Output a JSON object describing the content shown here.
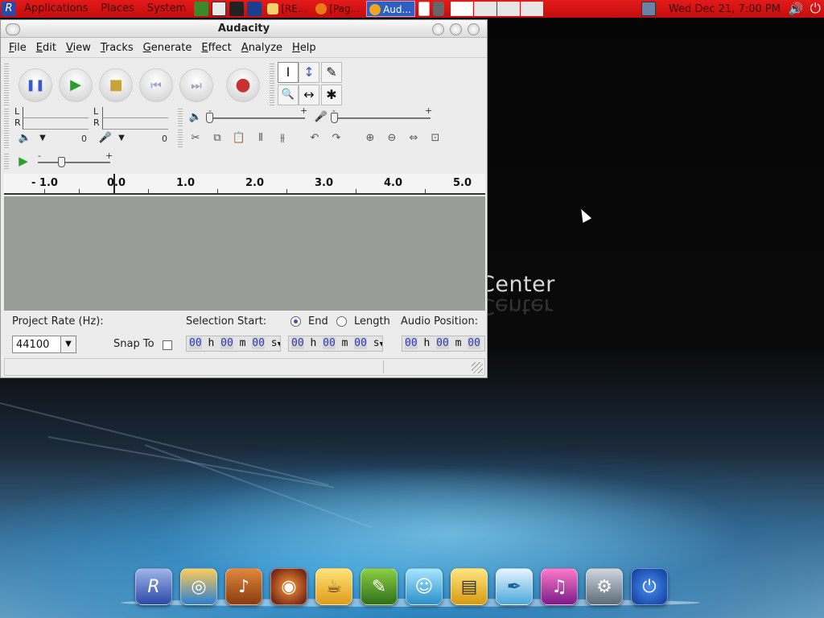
{
  "top_panel": {
    "menus": [
      "Applications",
      "Places",
      "System"
    ],
    "tasks": [
      {
        "label": "[RE...",
        "active": false
      },
      {
        "label": "[Pag...",
        "active": false
      },
      {
        "label": "Aud...",
        "active": true
      }
    ],
    "clock": "Wed Dec 21,  7:00 PM"
  },
  "window": {
    "title": "Audacity",
    "menus": [
      {
        "first": "F",
        "rest": "ile"
      },
      {
        "first": "E",
        "rest": "dit"
      },
      {
        "first": "V",
        "rest": "iew"
      },
      {
        "first": "T",
        "rest": "racks"
      },
      {
        "first": "G",
        "rest": "enerate"
      },
      {
        "first": "E",
        "rest": "ffect"
      },
      {
        "first": "A",
        "rest": "nalyze"
      },
      {
        "first": "H",
        "rest": "elp"
      }
    ],
    "transport": {
      "pause": "❚❚",
      "play": "▶",
      "stop": "■",
      "skip_start": "⏮",
      "skip_end": "⏭",
      "record": "●"
    },
    "tools": {
      "select": "I",
      "envelope": "↕",
      "draw": "✎",
      "zoom": "🔍",
      "timeshift": "↔",
      "multi": "✱"
    },
    "meters": {
      "left": "L",
      "right": "R",
      "play_value": "0",
      "rec_value": "0"
    },
    "mixer": {
      "min": "-",
      "max": "+"
    },
    "edit_icons": [
      "✂",
      "⧉",
      "📋",
      "⫴",
      "⫵",
      "↶",
      "↷",
      "⊕",
      "⊖",
      "⇔",
      "⊡"
    ],
    "ruler_ticks": [
      "- 1.0",
      "0.0",
      "1.0",
      "2.0",
      "3.0",
      "4.0",
      "5.0"
    ],
    "selection": {
      "project_rate_label": "Project Rate (Hz):",
      "project_rate_value": "44100",
      "snap_to_label": "Snap To",
      "selection_start_label": "Selection Start:",
      "end_label": "End",
      "length_label": "Length",
      "audio_position_label": "Audio Position:",
      "time_digits": {
        "h": "00",
        "m": "00",
        "s": "00"
      },
      "units": {
        "h": "h",
        "m": "m",
        "s": "s"
      }
    }
  },
  "background_text": "Center",
  "colors": {
    "panel_red": "#d61313",
    "active_task": "#2d5fbf",
    "track_bg": "#9a9c99",
    "time_digit": "#2c3ab8"
  },
  "dock_icons": [
    "redflag-icon",
    "browser-icon",
    "guitar-icon",
    "media-player-icon",
    "coffee-icon",
    "image-editor-icon",
    "messenger-icon",
    "office-icon",
    "feather-icon",
    "music-icon",
    "settings-icon",
    "power-icon"
  ]
}
